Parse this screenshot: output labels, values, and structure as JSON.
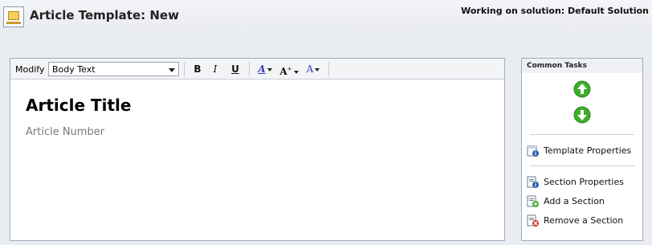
{
  "header": {
    "title": "Article Template: New",
    "solution_text": "Working on solution: Default Solution",
    "icon": "article-template-icon"
  },
  "toolbar": {
    "modify_label": "Modify",
    "style_select_value": "Body Text",
    "bold_label": "B",
    "italic_label": "I",
    "underline_label": "U",
    "font_color_label": "A",
    "font_size_label": "A",
    "highlight_label": "A"
  },
  "document": {
    "title": "Article Title",
    "subtitle": "Article Number"
  },
  "tasks": {
    "heading": "Common Tasks",
    "move_up_icon": "arrow-up-icon",
    "move_down_icon": "arrow-down-icon",
    "items": [
      {
        "label": "Template Properties",
        "icon": "template-properties-icon"
      },
      {
        "label": "Section Properties",
        "icon": "section-properties-icon"
      },
      {
        "label": "Add a Section",
        "icon": "add-section-icon"
      },
      {
        "label": "Remove a Section",
        "icon": "remove-section-icon"
      }
    ]
  },
  "colors": {
    "page_background": "#e9ecf1",
    "border": "#a5acb5",
    "arrow_green": "#3fae2a",
    "font_color_accent": "#3b3bb8"
  }
}
